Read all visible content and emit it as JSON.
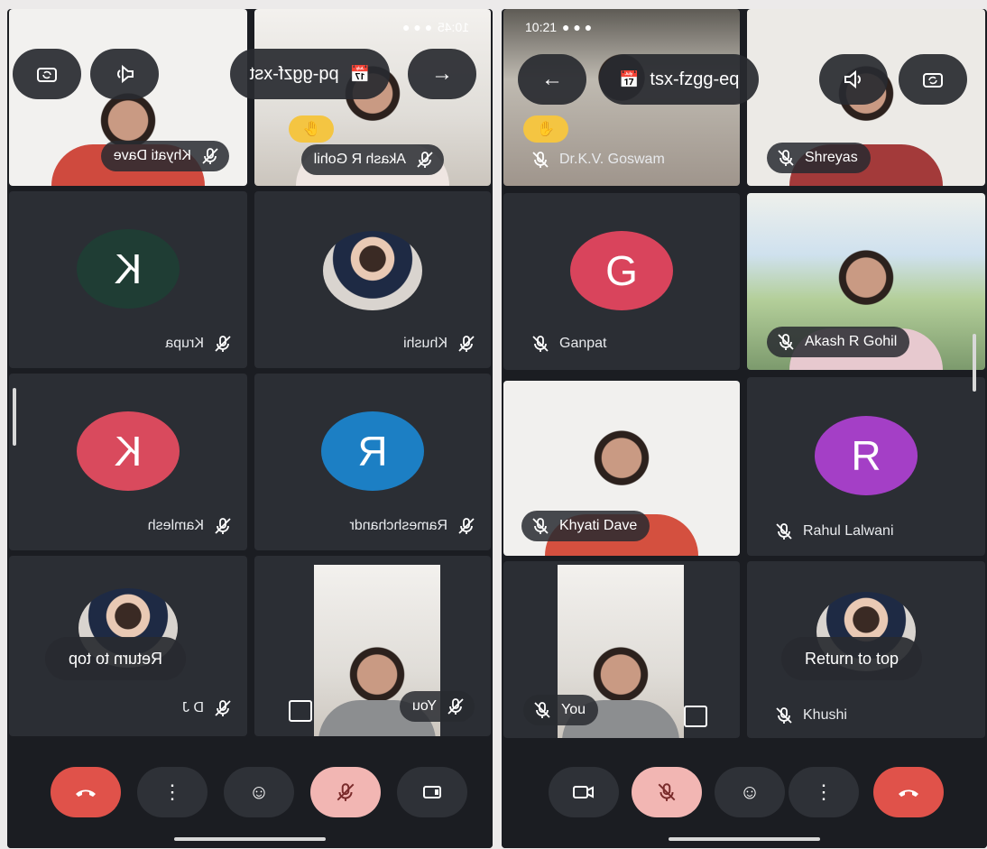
{
  "left_phone": {
    "status_time": "10:45",
    "meeting_code": "pq-ggzf-xst",
    "tiles": {
      "khyati": "Khyati Dave",
      "akash": "Akash R Gohil",
      "krupa": "Krupa",
      "krupa_initial": "K",
      "khushi": "Khushi",
      "kamlesh": "Kamlesh",
      "kamlesh_initial": "K",
      "rameshchandra": "Rameshchandr",
      "rameshchandra_initial": "R",
      "dj": "D J",
      "you": "You"
    },
    "return_to_top": "Return to top"
  },
  "right_phone": {
    "status_time": "10:21",
    "meeting_code": "tsx-fzgg-eq",
    "tiles": {
      "goswami": "Dr.K.V. Goswam",
      "shreyas": "Shreyas",
      "ganpat": "Ganpat",
      "ganpat_initial": "G",
      "akash": "Akash R Gohil",
      "khyati": "Khyati Dave",
      "rahul": "Rahul Lalwani",
      "rahul_initial": "R",
      "you": "You",
      "khushi": "Khushi"
    },
    "return_to_top": "Return to top"
  },
  "icons": {
    "hand_raise": "✋",
    "arrow": "→",
    "back_arrow": "←",
    "calendar": "📅",
    "more": "⋮",
    "emoji": "☺",
    "camera": "▭",
    "present": "⧉"
  },
  "colors": {
    "krupa": "#1f3d34",
    "kamlesh": "#d94a5d",
    "rameshchandra": "#1c7fc4",
    "ganpat": "#d9445c",
    "rahul": "#a43fc6",
    "end_call": "#e0524a",
    "mic_off": "#f2b6b3"
  }
}
